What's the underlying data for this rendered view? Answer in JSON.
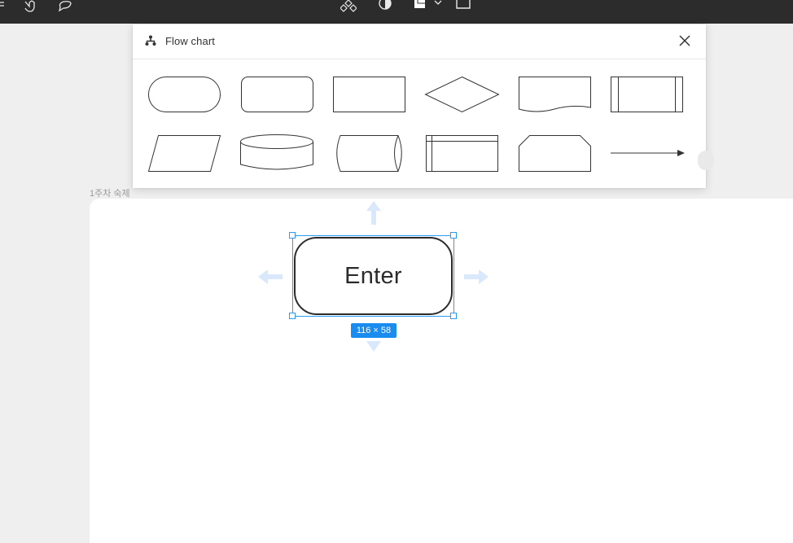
{
  "toolbar": {
    "icons": [
      "pen-icon",
      "hand-icon",
      "comment-icon",
      "component-icon",
      "contrast-icon",
      "shape-icon",
      "chevron-down-icon",
      "frame-icon"
    ]
  },
  "frame": {
    "label": "1주차 숙제"
  },
  "panel": {
    "title": "Flow chart",
    "icon": "flowchart-icon",
    "shapes": [
      "terminator-shape",
      "rounded-rectangle-shape",
      "rectangle-shape",
      "diamond-shape",
      "document-shape",
      "predefined-process-shape",
      "parallelogram-shape",
      "database-shape",
      "cylinder-shape",
      "internal-storage-shape",
      "manual-operation-shape",
      "arrow-connector-shape"
    ]
  },
  "node": {
    "label": "Enter"
  },
  "selection": {
    "size": "116 × 58"
  },
  "colors": {
    "selection": "#2f9bf0",
    "badge": "#1a8cf0",
    "toolbar": "#2c2c2c",
    "canvas": "#efefef"
  }
}
